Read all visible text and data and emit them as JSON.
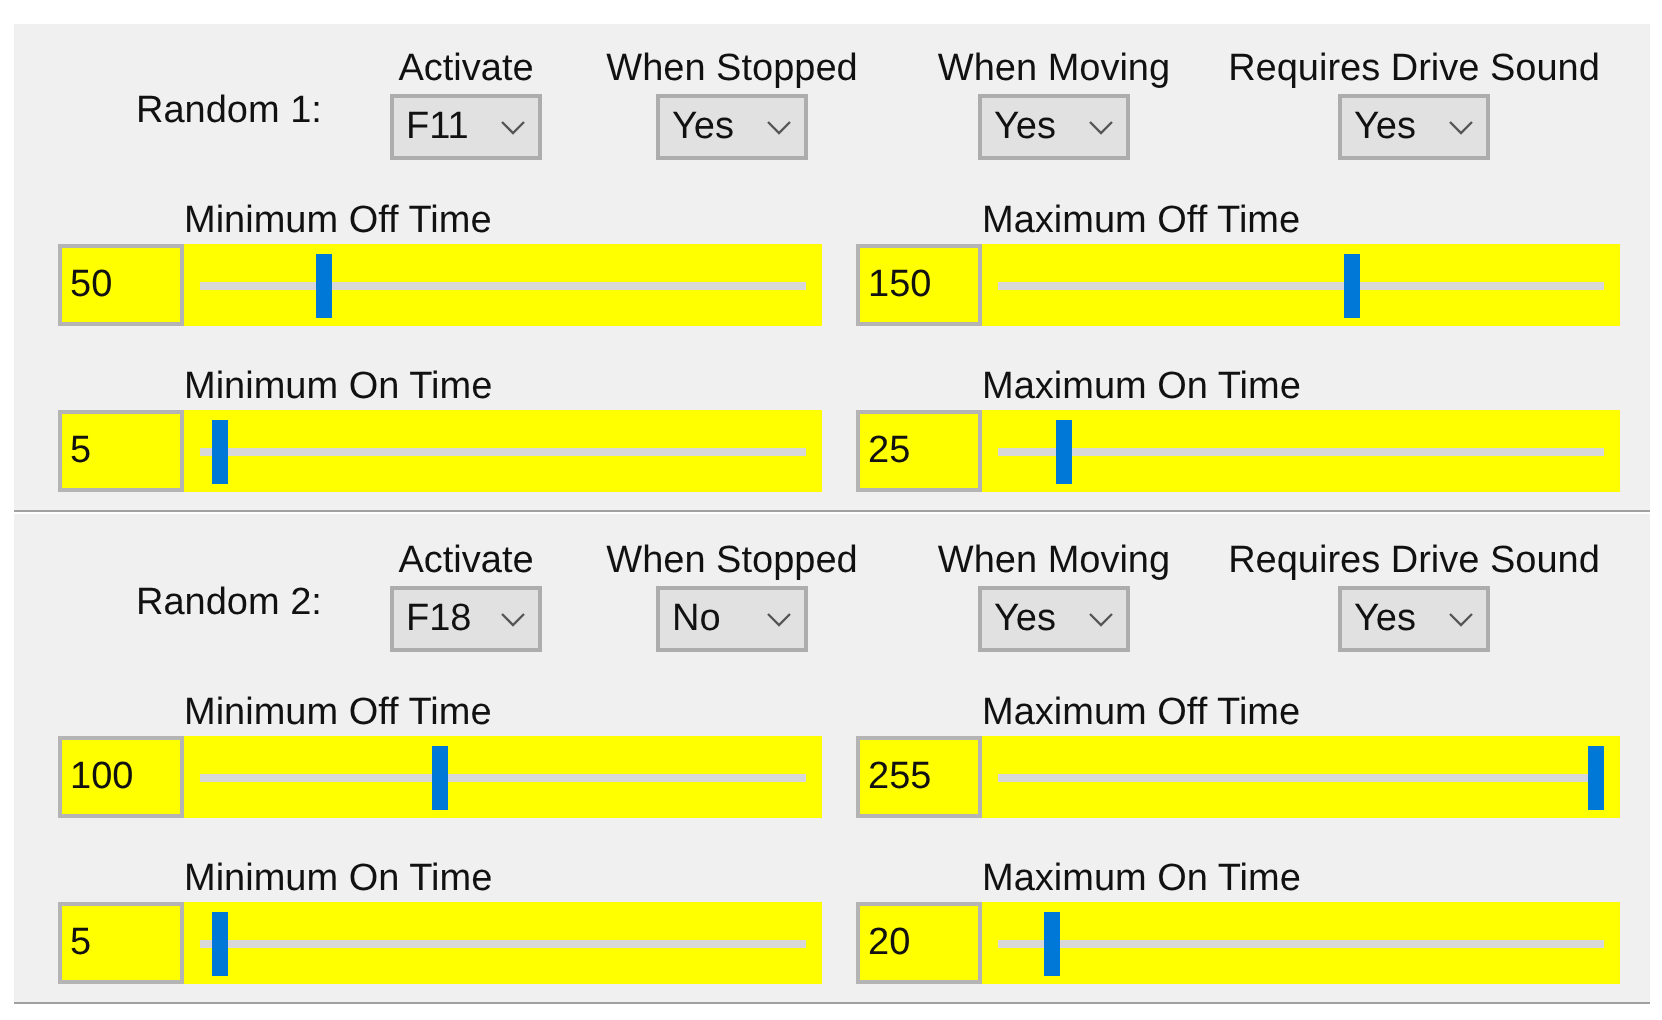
{
  "sections": [
    {
      "label": "Random 1:",
      "options": [
        {
          "label": "Activate",
          "value": "F11"
        },
        {
          "label": "When Stopped",
          "value": "Yes"
        },
        {
          "label": "When Moving",
          "value": "Yes"
        },
        {
          "label": "Requires Drive Sound",
          "value": "Yes"
        }
      ],
      "sliders": [
        {
          "label": "Minimum Off Time",
          "value": "50",
          "level": 0.196
        },
        {
          "label": "Maximum Off Time",
          "value": "150",
          "level": 0.588
        },
        {
          "label": "Minimum On Time",
          "value": "5",
          "level": 0.02
        },
        {
          "label": "Maximum On Time",
          "value": "25",
          "level": 0.098
        }
      ]
    },
    {
      "label": "Random 2:",
      "options": [
        {
          "label": "Activate",
          "value": "F18"
        },
        {
          "label": "When Stopped",
          "value": "No"
        },
        {
          "label": "When Moving",
          "value": "Yes"
        },
        {
          "label": "Requires Drive Sound",
          "value": "Yes"
        }
      ],
      "sliders": [
        {
          "label": "Minimum Off Time",
          "value": "100",
          "level": 0.392
        },
        {
          "label": "Maximum Off Time",
          "value": "255",
          "level": 1
        },
        {
          "label": "Minimum On Time",
          "value": "5",
          "level": 0.02
        },
        {
          "label": "Maximum On Time",
          "value": "20",
          "level": 0.078
        }
      ]
    }
  ]
}
